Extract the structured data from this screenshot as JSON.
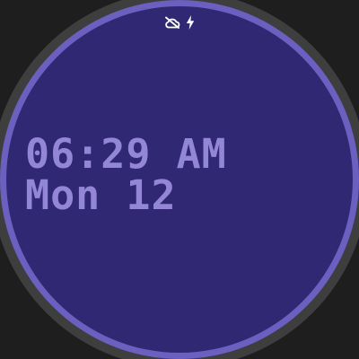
{
  "watchface": {
    "time": "06:29 AM",
    "date": "Mon 12"
  },
  "status_icons": [
    "cloud-off-icon",
    "lightning-bolt-icon"
  ],
  "colors": {
    "background": "#1e1e1e",
    "bezel": "#3e3e3e",
    "ring_accent": "#6b5fc0",
    "dial": "#302873",
    "text": "#9386d6",
    "status_icons": "#ffffff"
  }
}
